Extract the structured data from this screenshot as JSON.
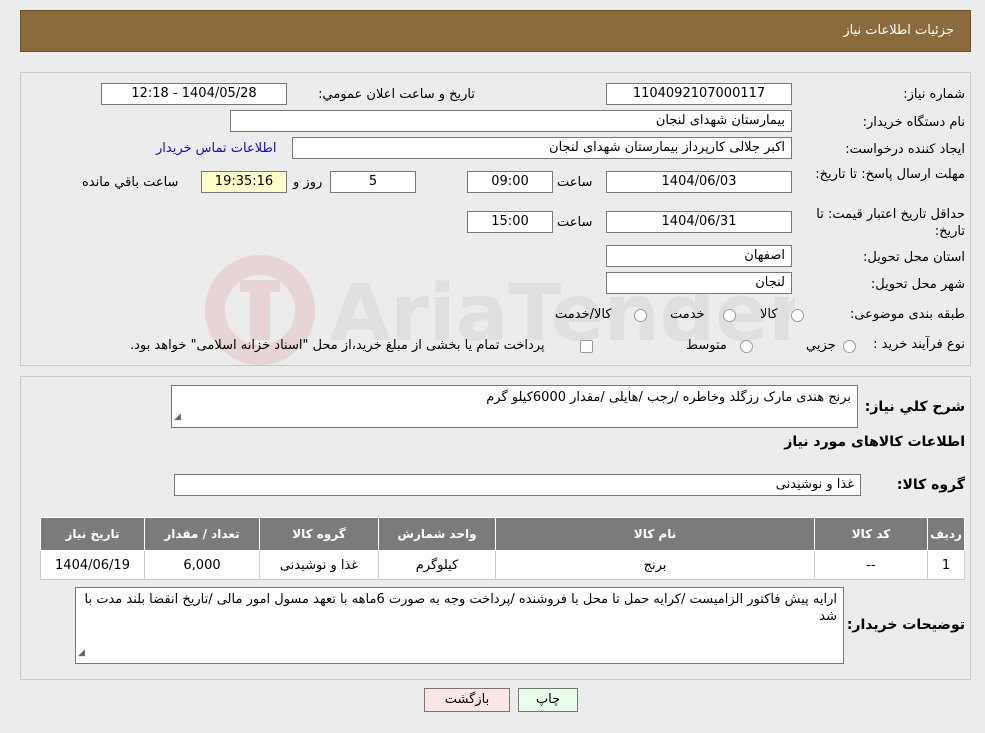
{
  "header": {
    "title": "جزئیات اطلاعات نیاز"
  },
  "labels": {
    "need_number": "شماره نیاز:",
    "announce_datetime": "تاریخ و ساعت اعلان عمومي:",
    "buyer_org": "نام دستگاه خريدار:",
    "requester": "ايجاد کننده درخواست:",
    "contact_link": "اطلاعات تماس خریدار",
    "reply_deadline": "مهلت ارسال پاسخ: تا تاریخ:",
    "time": "ساعت",
    "day_and": "روز و",
    "time_remaining": "ساعت باقي مانده",
    "price_validity": "حداقل تاريخ اعتبار قيمت: تا تاريخ:",
    "province": "استان محل تحويل:",
    "city": "شهر محل تحويل:",
    "category": "طبقه بندی موضوعی:",
    "process_type": "نوع فرآیند خرید :",
    "general_desc": "شرح کلي نياز:",
    "goods_info": "اطلاعات کالاهای مورد نياز",
    "goods_group": "گروه کالا:",
    "buyer_notes": "توضیحات خریدار:"
  },
  "values": {
    "need_number": "1104092107000117",
    "announce_datetime": "1404/05/28 - 12:18",
    "buyer_org": "بیمارستان شهدای لنجان",
    "requester": "اکبر جلالی کارپرداز بیمارستان شهدای لنجان",
    "reply_date": "1404/06/03",
    "reply_time": "09:00",
    "days": "5",
    "remaining": "19:35:16",
    "price_date": "1404/06/31",
    "price_time": "15:00",
    "province": "اصفهان",
    "city": "لنجان",
    "general_desc": "برنج هندی مارک رزگلد وخاطره /رجب /هایلی /مقدار 6000کیلو گرم",
    "goods_group": "غذا و نوشیدنی",
    "buyer_notes": "ارایه پیش فاکتور الزامیست /کرایه حمل تا محل با فروشنده /پرداخت وجه به صورت 6ماهه با تعهد مسول امور مالی /تاریخ انقضا بلند مدت با شد"
  },
  "category_options": [
    "کالا",
    "خدمت",
    "کالا/خدمت"
  ],
  "process_options": [
    "جزيي",
    "متوسط"
  ],
  "process_note": "پرداخت تمام يا بخشی از مبلغ خريد،از محل \"اسناد خزانه اسلامی\" خواهد بود.",
  "table": {
    "headers": [
      "رديف",
      "کد کالا",
      "نام کالا",
      "واحد شمارش",
      "گروه کالا",
      "تعداد / مقدار",
      "تاريخ نياز"
    ],
    "rows": [
      [
        "1",
        "--",
        "برنج",
        "کیلوگرم",
        "غذا و نوشیدنی",
        "6,000",
        "1404/06/19"
      ]
    ]
  },
  "buttons": {
    "print": "چاپ",
    "back": "بازگشت"
  },
  "watermark": "AriaTender.neT"
}
